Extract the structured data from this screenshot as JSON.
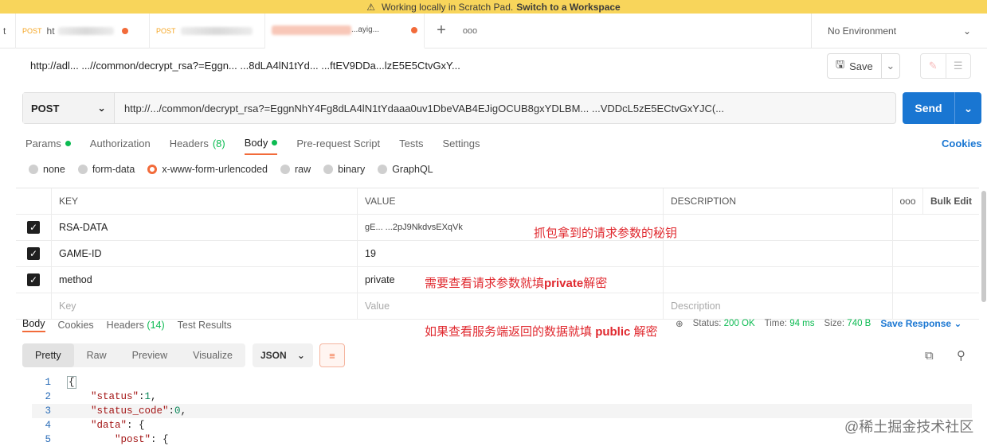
{
  "banner": {
    "text": "Working locally in Scratch Pad.",
    "link": "Switch to a Workspace"
  },
  "tabs": {
    "items": [
      {
        "method": "",
        "label": "t"
      },
      {
        "method": "POST",
        "label": "ht"
      },
      {
        "method": "POST",
        "label": ""
      },
      {
        "method": "",
        "label": "...ayig..."
      }
    ],
    "add_label": "+",
    "more_label": "ooo"
  },
  "environment": {
    "label": "No Environment",
    "chevron": "⌄"
  },
  "request": {
    "title": "http://adl...  ...//common/decrypt_rsa?=Eggn...  ...8dLA4lN1tYd...  ...ftEV9DDa...lzE5E5CtvGxY...",
    "method": "POST",
    "url": "http://.../common/decrypt_rsa?=EggnNhY4Fg8dLA4lN1tYdaaa0uv1DbeVAB4EJigOCUB8gxYDLBM... ...VDDcL5zE5ECtvGxYJC(...",
    "save_label": "Save",
    "send_label": "Send"
  },
  "request_tabs": [
    {
      "label": "Params",
      "dot": true,
      "count": ""
    },
    {
      "label": "Authorization",
      "dot": false,
      "count": ""
    },
    {
      "label": "Headers",
      "dot": false,
      "count": "(8)"
    },
    {
      "label": "Body",
      "dot": true,
      "count": ""
    },
    {
      "label": "Pre-request Script",
      "dot": false,
      "count": ""
    },
    {
      "label": "Tests",
      "dot": false,
      "count": ""
    },
    {
      "label": "Settings",
      "dot": false,
      "count": ""
    }
  ],
  "cookies_label": "Cookies",
  "body_types": [
    "none",
    "form-data",
    "x-www-form-urlencoded",
    "raw",
    "binary",
    "GraphQL"
  ],
  "body_type_selected": "x-www-form-urlencoded",
  "params_table": {
    "headers": {
      "key": "KEY",
      "value": "VALUE",
      "description": "DESCRIPTION",
      "more": "ooo",
      "bulk": "Bulk Edit"
    },
    "rows": [
      {
        "key": "RSA-DATA",
        "value": "gE... ...2pJ9NkdvsEXqVk",
        "checked": true
      },
      {
        "key": "GAME-ID",
        "value": "19",
        "checked": true
      },
      {
        "key": "method",
        "value": "private",
        "checked": true
      }
    ],
    "placeholder": {
      "key": "Key",
      "value": "Value",
      "description": "Description"
    }
  },
  "annotations": {
    "a1": "抓包拿到的请求参数的秘钥",
    "a2_pre": "需要查看请求参数就填",
    "a2_bold": "private",
    "a2_post": "解密",
    "a3_pre": "如果查看服务端返回的数据就填",
    "a3_bold": "public",
    "a3_post": "解密"
  },
  "response_tabs": [
    {
      "label": "Body",
      "count": ""
    },
    {
      "label": "Cookies",
      "count": ""
    },
    {
      "label": "Headers",
      "count": "(14)"
    },
    {
      "label": "Test Results",
      "count": ""
    }
  ],
  "response_status": {
    "status_label": "Status:",
    "status_value": "200 OK",
    "time_label": "Time:",
    "time_value": "94 ms",
    "size_label": "Size:",
    "size_value": "740 B",
    "save_response": "Save Response"
  },
  "view_modes": [
    "Pretty",
    "Raw",
    "Preview",
    "Visualize"
  ],
  "view_selected": "Pretty",
  "format": "JSON",
  "code_lines": [
    {
      "n": "1",
      "text": "{"
    },
    {
      "n": "2",
      "key": "\"status\"",
      "rest": ": ",
      "val": "1",
      "tail": ","
    },
    {
      "n": "3",
      "key": "\"status_code\"",
      "rest": ": ",
      "val": "0",
      "tail": ","
    },
    {
      "n": "4",
      "key": "\"data\"",
      "rest": ": {",
      "val": "",
      "tail": ""
    },
    {
      "n": "5",
      "key": "\"post\"",
      "rest": ": {",
      "val": "",
      "tail": ""
    }
  ],
  "watermark": "@稀土掘金技术社区"
}
